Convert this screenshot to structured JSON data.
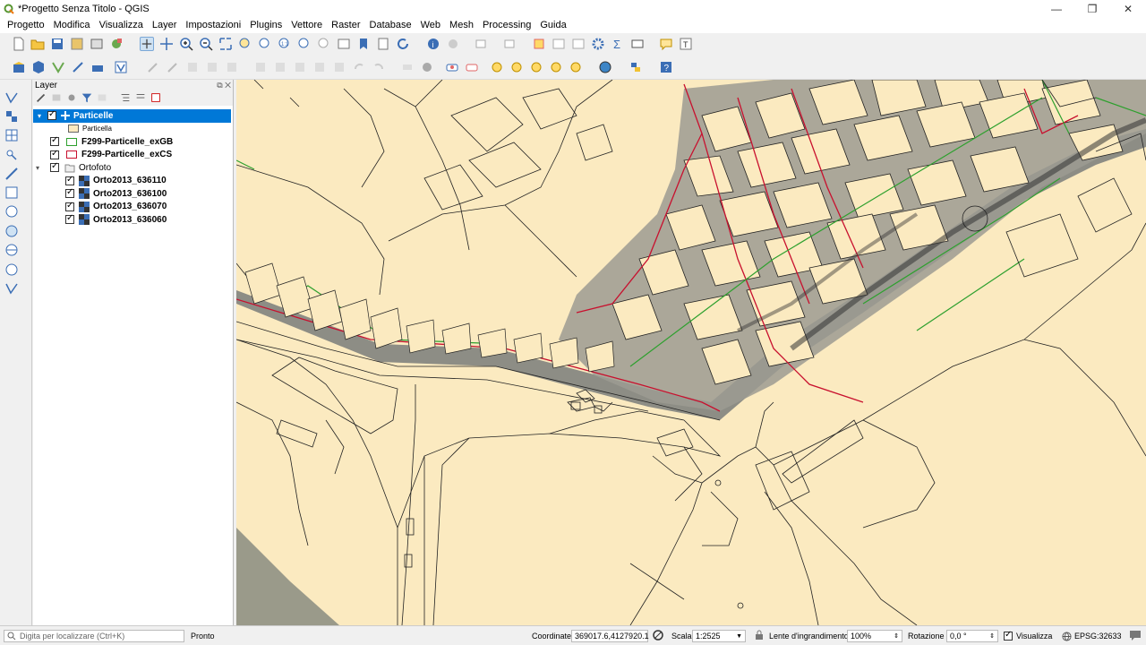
{
  "window": {
    "title": "*Progetto Senza Titolo - QGIS",
    "minimize": "—",
    "maximize": "❐",
    "close": "✕"
  },
  "menu": [
    "Progetto",
    "Modifica",
    "Visualizza",
    "Layer",
    "Impostazioni",
    "Plugins",
    "Vettore",
    "Raster",
    "Database",
    "Web",
    "Mesh",
    "Processing",
    "Guida"
  ],
  "layer_panel": {
    "title": "Layer",
    "layers": [
      {
        "name": "Particelle",
        "selected": true,
        "bold": true
      },
      {
        "legend": "Particella"
      },
      {
        "name": "F299-Particelle_exGB",
        "bold": true
      },
      {
        "name": "F299-Particelle_exCS",
        "bold": true
      },
      {
        "name": "Ortofoto",
        "group": true
      },
      {
        "name": "Orto2013_636110",
        "bold": true
      },
      {
        "name": "Orto2013_636100",
        "bold": true
      },
      {
        "name": "Orto2013_636070",
        "bold": true
      },
      {
        "name": "Orto2013_636060",
        "bold": true
      }
    ]
  },
  "status": {
    "locator_placeholder": "Digita per localizzare (Ctrl+K)",
    "message": "Pronto",
    "coord_label": "Coordinate",
    "coord_value": "369017.6,4127920.1",
    "scale_label": "Scala",
    "scale_value": "1:2525",
    "magnifier_label": "Lente d'ingrandimento",
    "magnifier_value": "100%",
    "rotation_label": "Rotazione",
    "rotation_value": "0,0 °",
    "render_label": "Visualizza",
    "crs": "EPSG:32633"
  },
  "colors": {
    "parcel_fill": "#fbeac0",
    "selection": "#0078d7",
    "red_layer": "#c8102e",
    "green_layer": "#2ea02e"
  }
}
